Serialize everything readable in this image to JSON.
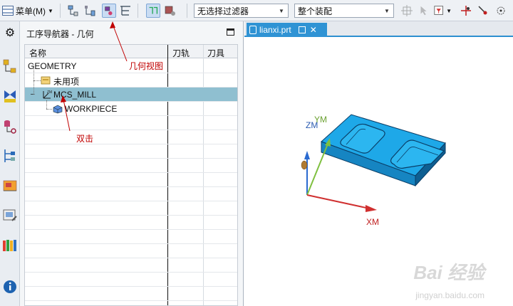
{
  "toolbar": {
    "menu_label": "菜单(M)",
    "filter_select": "无选择过滤器",
    "assembly_select": "整个装配"
  },
  "navigator": {
    "title": "工序导航器 - 几何",
    "columns": [
      "名称",
      "刀轨",
      "刀具"
    ],
    "rows": [
      {
        "label": "GEOMETRY"
      },
      {
        "label": "未用项"
      },
      {
        "label": "MCS_MILL"
      },
      {
        "label": "WORKPIECE"
      }
    ]
  },
  "annotations": {
    "geometry_view": "几何视图",
    "double_click": "双击"
  },
  "graphics": {
    "tab_label": "lianxi.prt",
    "axis_x": "XM",
    "axis_y": "YM",
    "axis_z": "ZM"
  },
  "watermark": {
    "brand": "Bai 经验",
    "url": "jingyan.baidu.com"
  },
  "icons": [
    "menu-icon",
    "geometry-view-icon",
    "part-icon",
    "filter-icon"
  ]
}
